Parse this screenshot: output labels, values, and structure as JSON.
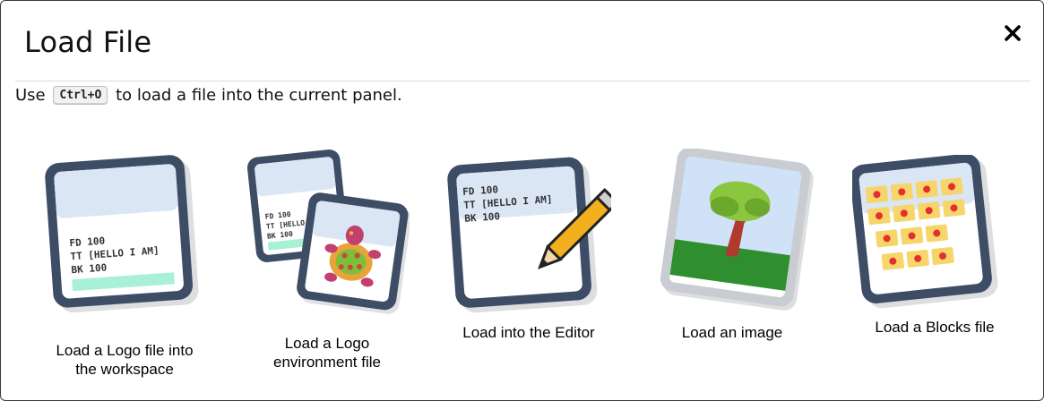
{
  "dialog": {
    "title": "Load File",
    "close_icon": "close-icon"
  },
  "hint": {
    "prefix": "Use",
    "shortcut": "Ctrl+O",
    "suffix": "to load a file into the current panel."
  },
  "options": [
    {
      "label_line1": "Load a Logo file into",
      "label_line2": "the workspace",
      "icon": "logo-file-icon",
      "code_lines": [
        "FD 100",
        "TT [HELLO I AM]",
        "BK 100"
      ]
    },
    {
      "label_line1": "Load a Logo",
      "label_line2": "environment file",
      "icon": "environment-file-icon",
      "code_lines": [
        "FD 100",
        "TT [HELLO I",
        "BK 100"
      ]
    },
    {
      "label_line1": "Load into the Editor",
      "icon": "editor-file-icon",
      "code_lines": [
        "FD 100",
        "TT [HELLO I AM]",
        "BK 100"
      ]
    },
    {
      "label_line1": "Load an image",
      "icon": "image-file-icon"
    },
    {
      "label_line1": "Load a Blocks file",
      "icon": "blocks-file-icon"
    }
  ],
  "colors": {
    "frame": "#3d4d66",
    "highlight": "#a8f0d6",
    "pencil": "#f2b01e",
    "grass": "#2f8f2f",
    "tree": "#8cc63e",
    "trunk": "#b03a2e"
  }
}
